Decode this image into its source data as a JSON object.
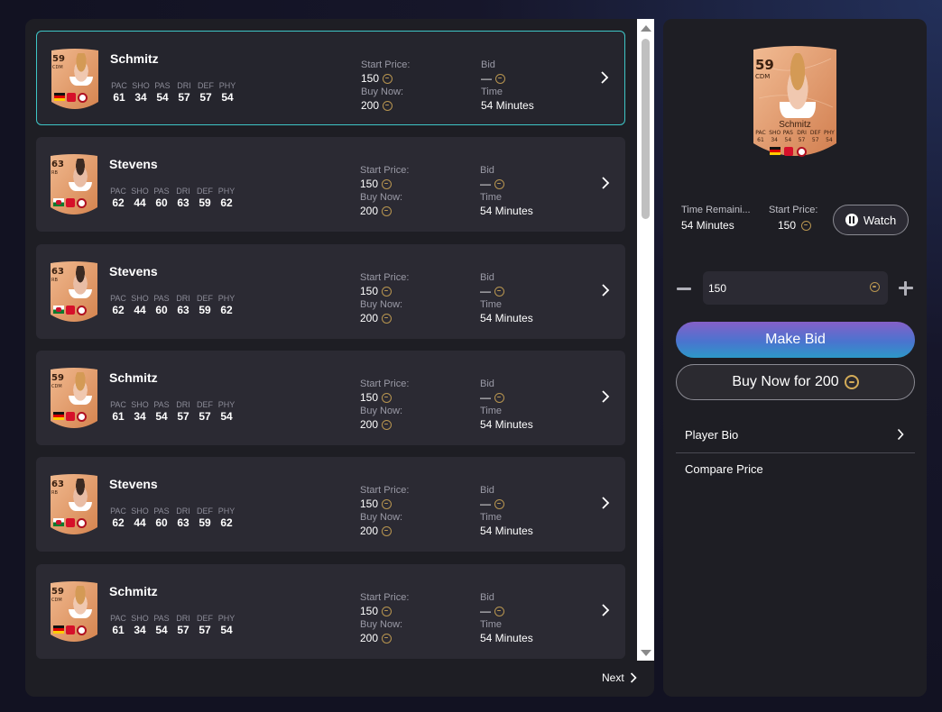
{
  "listing": {
    "start_price_label": "Start Price:",
    "buy_now_label": "Buy Now:",
    "bid_label": "Bid",
    "time_label": "Time",
    "stat_labels": [
      "PAC",
      "SHO",
      "PAS",
      "DRI",
      "DEF",
      "PHY"
    ],
    "rows": [
      {
        "name": "Schmitz",
        "rating": "59",
        "position": "CDM",
        "nation": "germany",
        "stats": [
          "61",
          "34",
          "54",
          "57",
          "57",
          "54"
        ],
        "start_price": "150",
        "buy_now": "200",
        "bid": "—",
        "time": "54 Minutes",
        "selected": true
      },
      {
        "name": "Stevens",
        "rating": "63",
        "position": "RB",
        "nation": "wales",
        "stats": [
          "62",
          "44",
          "60",
          "63",
          "59",
          "62"
        ],
        "start_price": "150",
        "buy_now": "200",
        "bid": "—",
        "time": "54 Minutes",
        "selected": false
      },
      {
        "name": "Stevens",
        "rating": "63",
        "position": "RB",
        "nation": "wales",
        "stats": [
          "62",
          "44",
          "60",
          "63",
          "59",
          "62"
        ],
        "start_price": "150",
        "buy_now": "200",
        "bid": "—",
        "time": "54 Minutes",
        "selected": false
      },
      {
        "name": "Schmitz",
        "rating": "59",
        "position": "CDM",
        "nation": "germany",
        "stats": [
          "61",
          "34",
          "54",
          "57",
          "57",
          "54"
        ],
        "start_price": "150",
        "buy_now": "200",
        "bid": "—",
        "time": "54 Minutes",
        "selected": false
      },
      {
        "name": "Stevens",
        "rating": "63",
        "position": "RB",
        "nation": "wales",
        "stats": [
          "62",
          "44",
          "60",
          "63",
          "59",
          "62"
        ],
        "start_price": "150",
        "buy_now": "200",
        "bid": "—",
        "time": "54 Minutes",
        "selected": false
      },
      {
        "name": "Schmitz",
        "rating": "59",
        "position": "CDM",
        "nation": "germany",
        "stats": [
          "61",
          "34",
          "54",
          "57",
          "57",
          "54"
        ],
        "start_price": "150",
        "buy_now": "200",
        "bid": "—",
        "time": "54 Minutes",
        "selected": false
      }
    ],
    "next_label": "Next"
  },
  "detail": {
    "card": {
      "name": "Schmitz",
      "rating": "59",
      "position": "CDM",
      "stat_labels": [
        "PAC",
        "SHO",
        "PAS",
        "DRI",
        "DEF",
        "PHY"
      ],
      "stats": [
        "61",
        "34",
        "54",
        "57",
        "57",
        "54"
      ]
    },
    "time_remaining_label": "Time Remaini...",
    "time_remaining_value": "54 Minutes",
    "start_price_label": "Start Price:",
    "start_price_value": "150",
    "watch_label": "Watch",
    "bid_input_value": "150",
    "make_bid_label": "Make Bid",
    "buy_now_label": "Buy Now for 200",
    "player_bio_label": "Player Bio",
    "compare_price_label": "Compare Price"
  },
  "colors": {
    "card_bronze": "#d9895a",
    "card_bronze_light": "#eeb48c",
    "coin": "#b89550",
    "selected_border": "#3ec6c6",
    "panel_bg": "#1e1e24",
    "row_bg": "#2b2a33"
  }
}
